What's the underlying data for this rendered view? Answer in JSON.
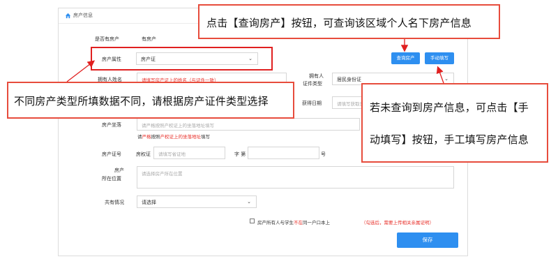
{
  "panel": {
    "title": "房产信息"
  },
  "form": {
    "has_property": {
      "label": "是否有房产",
      "value": "有房产"
    },
    "property_attr": {
      "label": "房产属性",
      "value": "房产证"
    },
    "owner_name": {
      "label": "拥有人姓名",
      "placeholder": "请填写房产证上的姓名（与证件一致）"
    },
    "owner_id_type": {
      "label_line1": "拥有人",
      "label_line2": "证件类型",
      "value": "居民身份证"
    },
    "acquire_date": {
      "label": "获得日期",
      "placeholder": "请填写获取日期"
    },
    "property_location": {
      "label": "房产坐落",
      "placeholder": "请严格按照产权证上的坐落地址填写",
      "hint_prefix": "请",
      "hint_red1": "严格",
      "hint_mid": "按照",
      "hint_red2": "产权证上的坐落地址",
      "hint_suffix": "填写"
    },
    "cert_no": {
      "label": "房产证号",
      "prefix": "房权证",
      "placeholder": "请填写省证地",
      "mid": "字 第",
      "suffix": "号"
    },
    "address": {
      "label_line1": "房产",
      "label_line2": "所在位置",
      "placeholder": "请选择房产所在位置"
    },
    "co_ownership": {
      "label": "共有情况",
      "value": "请选择"
    },
    "checkbox": {
      "pre": "房产所有人与学生",
      "red": "不在",
      "post": "同一户口本上",
      "note": "（勾选后，需要上传相关亲属证明）"
    }
  },
  "buttons": {
    "query": "查询房产",
    "manual": "手动填写",
    "save": "保存"
  },
  "annotations": {
    "top": "点击【查询房产】按钮，可查询该区域个人名下房产信息",
    "left": "不同房产类型所填数据不同，请根据房产证件类型选择",
    "right_line1": "若未查询到房产信息，可点击【手",
    "right_line2": "动填写】按钮，手工填写房产信息"
  },
  "colors": {
    "accent": "#2e8ff0",
    "annotation_border": "#e74c3c",
    "hint_red": "#e8302a"
  }
}
